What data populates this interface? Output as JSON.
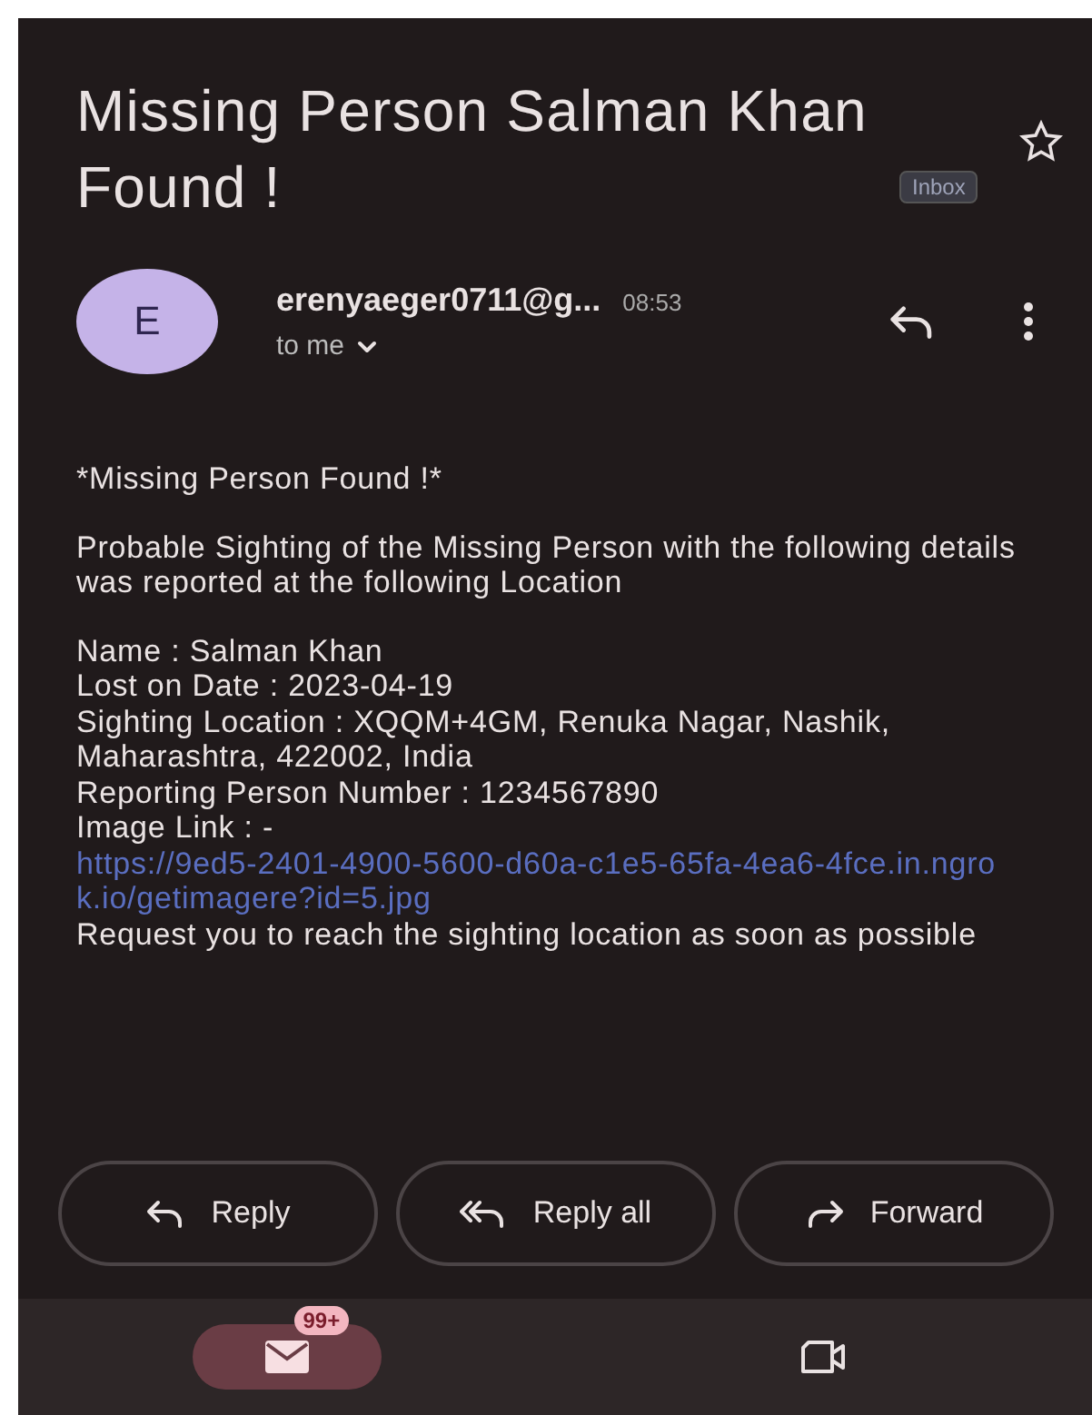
{
  "subject": "Missing Person Salman Khan Found !",
  "label": "Inbox",
  "starred": false,
  "sender": {
    "initial": "E",
    "address": "erenyaeger0711@g...",
    "time": "08:53",
    "recipient": "to me"
  },
  "body": {
    "heading": "*Missing Person Found !*",
    "intro": "Probable Sighting of the Missing Person with the following details was reported at the following Location",
    "details": [
      "Name : Salman Khan",
      "Lost on Date : 2023-04-19",
      "Sighting Location : XQQM+4GM, Renuka Nagar, Nashik, Maharashtra, 422002, India",
      "Reporting Person Number : 1234567890"
    ],
    "link_label": "Image Link : - ",
    "link": "https://9ed5-2401-4900-5600-d60a-c1e5-65fa-4ea6-4fce.in.ngrok.io/getimagere?id=5.jpg",
    "closing": "Request you to reach the sighting location as soon as possible"
  },
  "actions": [
    {
      "kind": "reply",
      "label": "Reply"
    },
    {
      "kind": "reply_all",
      "label": "Reply all"
    },
    {
      "kind": "forward",
      "label": "Forward"
    }
  ],
  "nav": [
    {
      "kind": "mail",
      "selected": true,
      "badge": "99+"
    },
    {
      "kind": "video",
      "selected": false
    }
  ]
}
